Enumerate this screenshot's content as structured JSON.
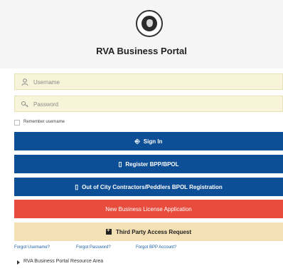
{
  "header": {
    "title": "RVA Business Portal",
    "seal_icon": "city-seal-icon"
  },
  "form": {
    "username": {
      "placeholder": "Username",
      "value": "",
      "icon": "user-icon"
    },
    "password": {
      "placeholder": "Password",
      "value": "",
      "icon": "key-icon"
    },
    "remember_label": "Remember username"
  },
  "buttons": {
    "sign_in": "Sign In",
    "register": "Register BPP/BPOL",
    "out_of_city": "Out of City Contractors/Peddlers BPOL Registration",
    "new_license": "New Business License Application",
    "third_party": "Third Party Access Request"
  },
  "links": {
    "forgot_username": "Forgot Username?",
    "forgot_password": "Forgot Password?",
    "forgot_bpp": "Forgot BPP Account?"
  },
  "resource": {
    "label": "RVA Business Portal Resource Area"
  },
  "colors": {
    "primary_blue": "#0d4f96",
    "danger_red": "#e74c3c",
    "tan": "#f3e0b4",
    "field_bg": "#f7f4d9",
    "link_blue": "#1c5fa6"
  }
}
